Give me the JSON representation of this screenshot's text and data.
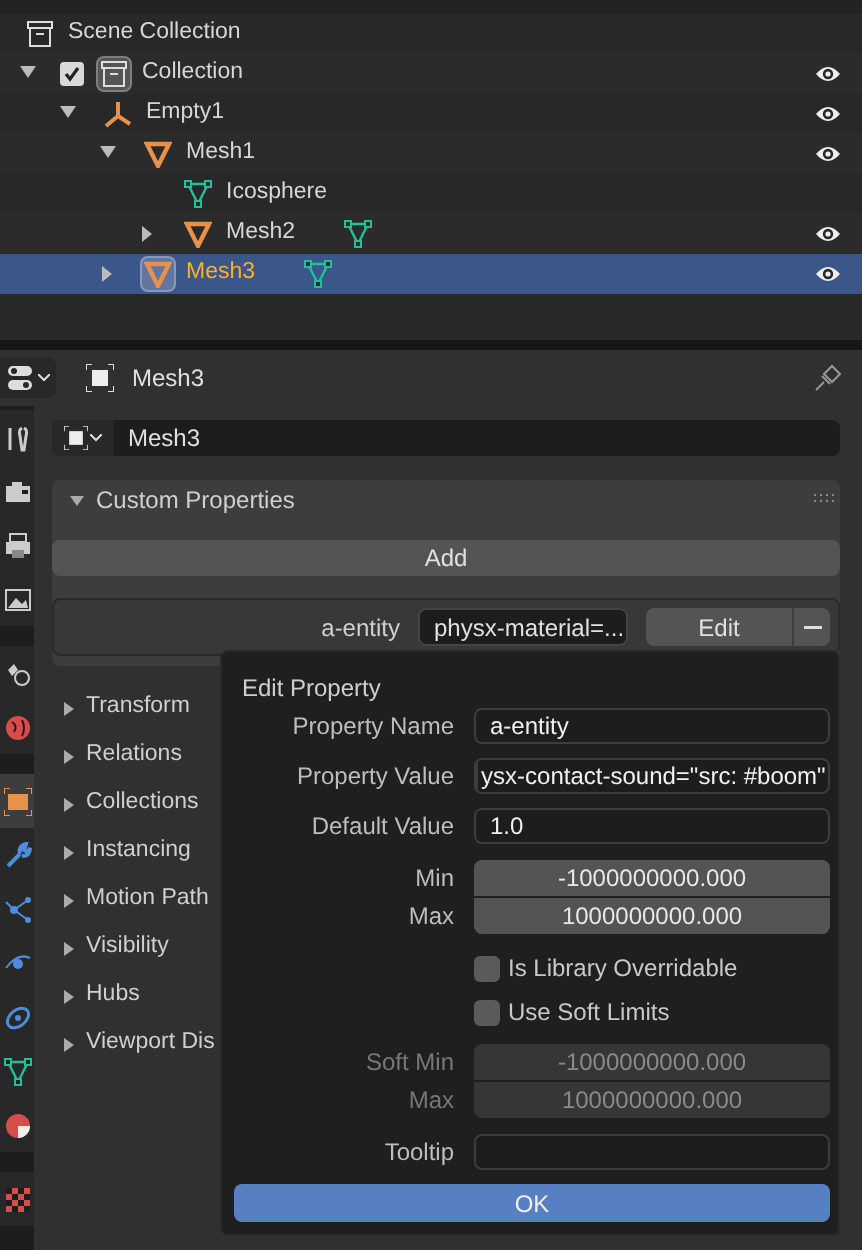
{
  "outliner": {
    "tree": [
      {
        "label": "Scene Collection",
        "kind": "scene_collection",
        "selected": false,
        "eye": false,
        "children": [
          {
            "label": "Collection",
            "kind": "collection",
            "expanded": true,
            "checked": true,
            "active": true,
            "selected": false,
            "eye": true,
            "children": [
              {
                "label": "Empty1",
                "kind": "empty",
                "expanded": true,
                "selected": false,
                "eye": true,
                "children": [
                  {
                    "label": "Mesh1",
                    "kind": "mesh",
                    "expanded": true,
                    "selected": false,
                    "eye": true,
                    "children": [
                      {
                        "label": "Icosphere",
                        "kind": "mesh_data",
                        "selected": false,
                        "eye": false
                      },
                      {
                        "label": "Mesh2",
                        "kind": "mesh",
                        "expanded": false,
                        "selected": false,
                        "eye": true,
                        "data_icon": true
                      }
                    ]
                  },
                  {
                    "label": "Mesh3",
                    "kind": "mesh",
                    "expanded": false,
                    "selected": true,
                    "active": true,
                    "eye": true,
                    "data_icon": true
                  }
                ]
              }
            ]
          }
        ]
      }
    ]
  },
  "properties": {
    "header": {
      "title": "Mesh3"
    },
    "tabs": [
      {
        "kind": "tool",
        "selected": false
      },
      {
        "kind": "render",
        "selected": false
      },
      {
        "kind": "output",
        "selected": false
      },
      {
        "kind": "view_layer",
        "selected": false
      },
      {
        "kind": "scene",
        "selected": false
      },
      {
        "kind": "world",
        "selected": false
      },
      {
        "kind": "object",
        "selected": true
      },
      {
        "kind": "modifiers",
        "selected": false
      },
      {
        "kind": "particles",
        "selected": false
      },
      {
        "kind": "physics",
        "selected": false
      },
      {
        "kind": "constraints",
        "selected": false
      },
      {
        "kind": "data",
        "selected": false
      },
      {
        "kind": "material",
        "selected": false
      },
      {
        "kind": "texture",
        "selected": false
      }
    ],
    "name_field": {
      "value": "Mesh3"
    },
    "custom_properties": {
      "title": "Custom Properties",
      "expanded": true,
      "add_button": "Add",
      "items": [
        {
          "name": "a-entity",
          "value": "physx-material=...",
          "edit_button": "Edit"
        }
      ]
    },
    "panels": [
      {
        "title": "Transform",
        "expanded": false
      },
      {
        "title": "Relations",
        "expanded": false
      },
      {
        "title": "Collections",
        "expanded": false
      },
      {
        "title": "Instancing",
        "expanded": false
      },
      {
        "title": "Motion Path",
        "expanded": false
      },
      {
        "title": "Visibility",
        "expanded": false
      },
      {
        "title": "Hubs",
        "expanded": false
      },
      {
        "title": "Viewport Dis",
        "expanded": false
      }
    ]
  },
  "edit_property_dialog": {
    "title": "Edit Property",
    "property_name": {
      "label": "Property Name",
      "value": "a-entity"
    },
    "property_value": {
      "label": "Property Value",
      "value": "ysx-contact-sound=\"src: #boom\"",
      "editing": true
    },
    "default_value": {
      "label": "Default Value",
      "value": "1.0"
    },
    "min": {
      "label": "Min",
      "value": "-1000000000.000"
    },
    "max": {
      "label": "Max",
      "value": "1000000000.000"
    },
    "is_library_overridable": {
      "label": "Is Library Overridable",
      "checked": false
    },
    "use_soft_limits": {
      "label": "Use Soft Limits",
      "checked": false
    },
    "soft_min": {
      "label": "Soft Min",
      "value": "-1000000000.000",
      "disabled": true
    },
    "soft_max": {
      "label": "Max",
      "value": "1000000000.000",
      "disabled": true
    },
    "tooltip": {
      "label": "Tooltip"
    },
    "ok_button": "OK"
  }
}
